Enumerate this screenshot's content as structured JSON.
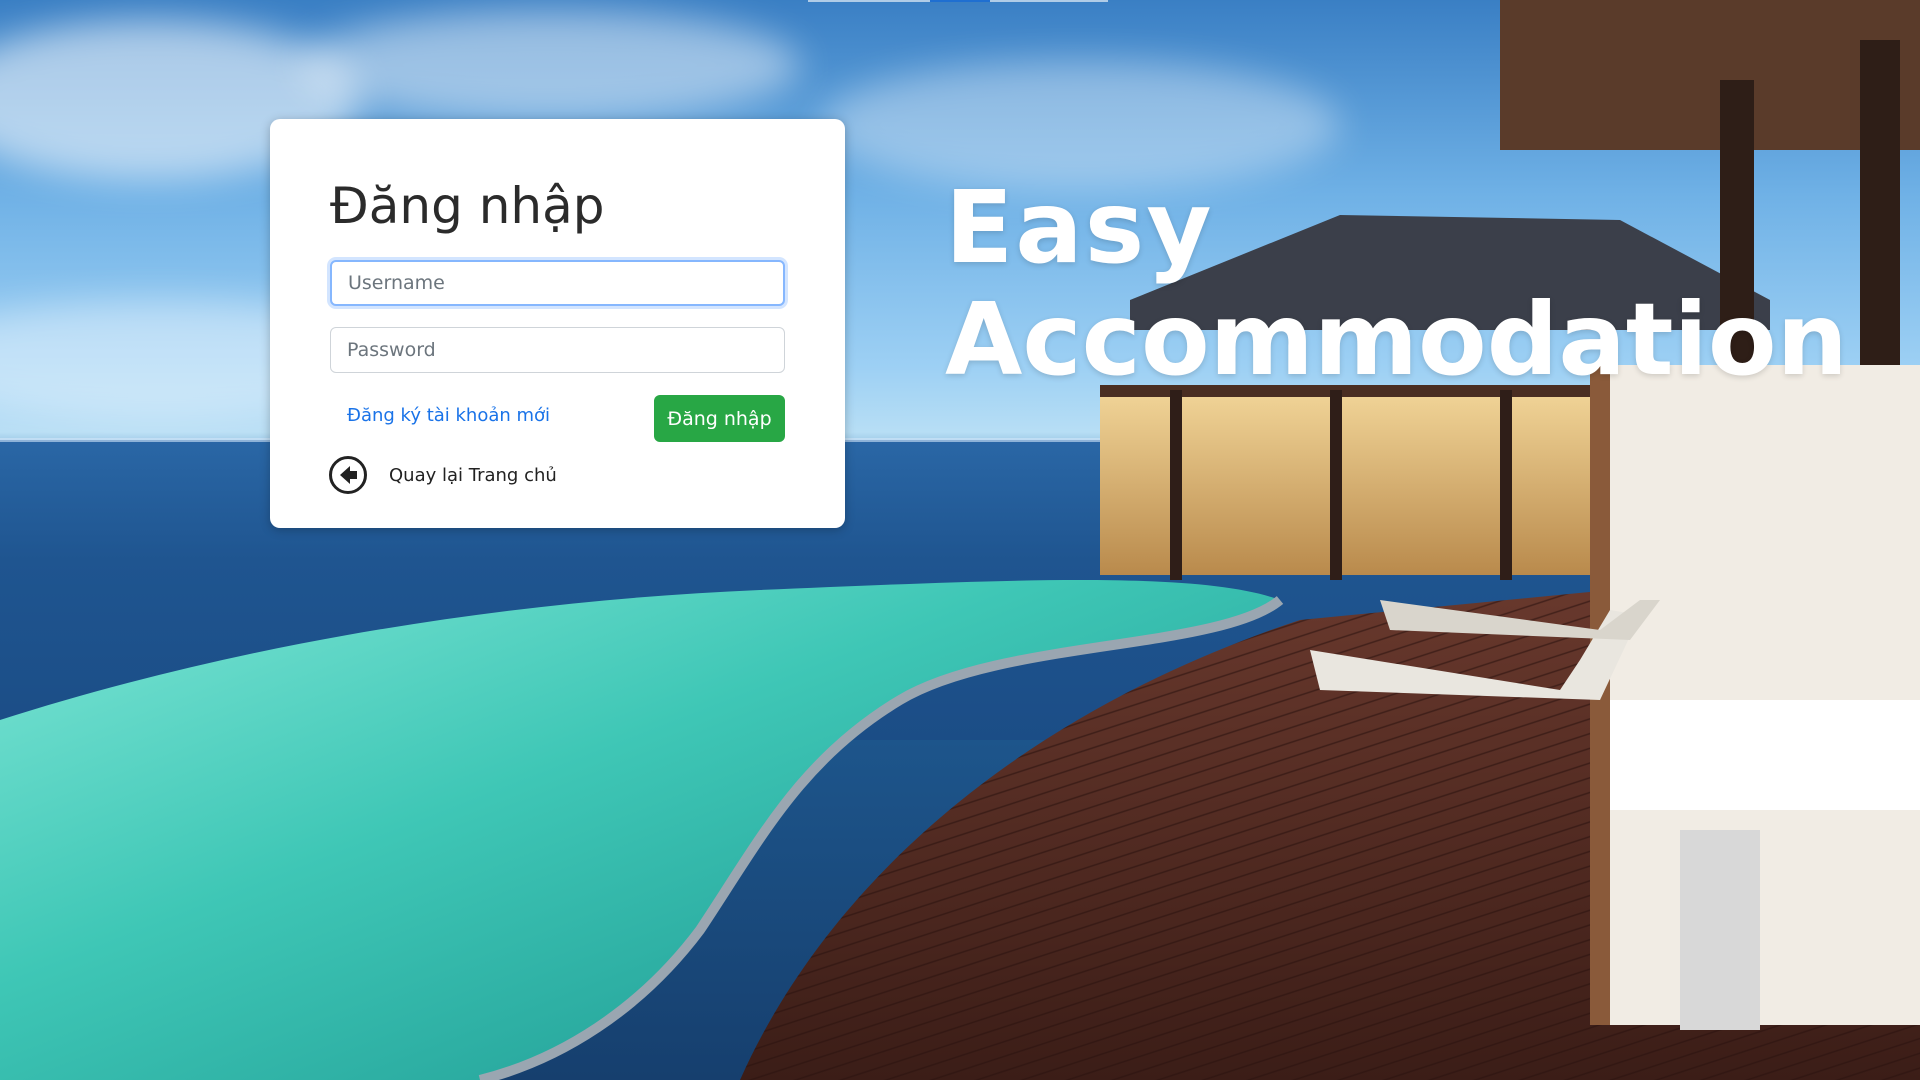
{
  "login": {
    "title": "Đăng nhập",
    "username_placeholder": "Username",
    "password_placeholder": "Password",
    "register_label": "Đăng ký tài khoản mới",
    "submit_label": "Đăng nhập",
    "back_label": "Quay lại Trang chủ"
  },
  "hero": {
    "line1": "Easy",
    "line2": "Accommodation"
  },
  "colors": {
    "submit_bg": "#28a745",
    "link": "#1a73e8",
    "focus_border": "#86b7fe"
  },
  "icons": {
    "back": "arrow-left-circle-icon"
  }
}
